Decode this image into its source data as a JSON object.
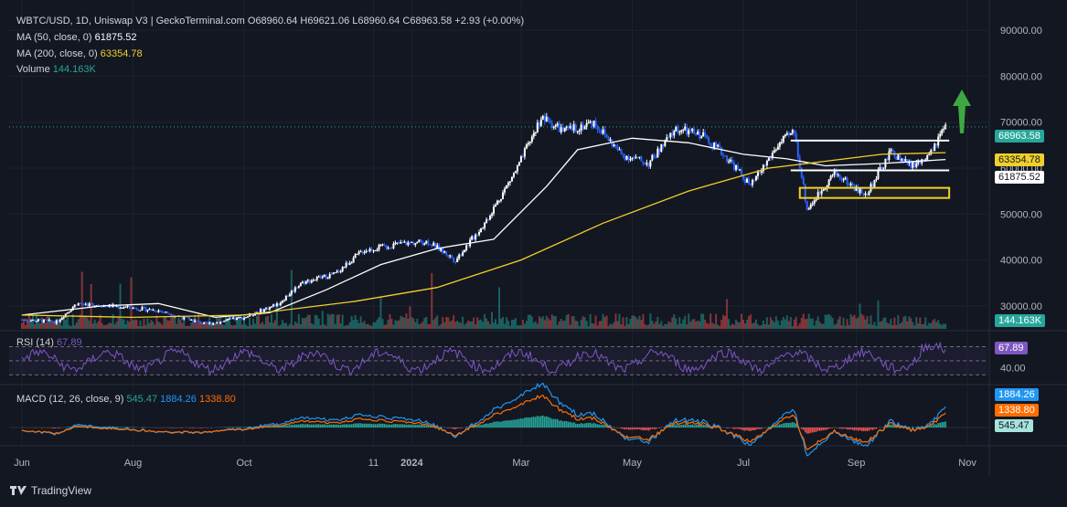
{
  "header": {
    "symbol": "WBTC/USD, 1D, Uniswap V3 | GeckoTerminal.com",
    "o_label": "O",
    "o": "68960.64",
    "h_label": "H",
    "h": "69621.06",
    "l_label": "L",
    "l": "68960.64",
    "c_label": "C",
    "c": "68963.58",
    "change": "+2.93 (+0.00%)"
  },
  "indicators": {
    "ma50_label": "MA (50, close, 0)",
    "ma50_value": "61875.52",
    "ma200_label": "MA (200, close, 0)",
    "ma200_value": "63354.78",
    "volume_label": "Volume",
    "volume_value": "144.163K",
    "rsi_label": "RSI (14)",
    "rsi_value": "67.89",
    "rsi_axis_40": "40.00",
    "macd_label": "MACD (12, 26, close, 9)",
    "macd_hist": "545.47",
    "macd_line": "1884.26",
    "macd_signal": "1338.80"
  },
  "price_tags": {
    "last": "68963.58",
    "ma200": "63354.78",
    "ma50": "61875.52",
    "volume": "144.163K",
    "rsi": "67.89",
    "macd_line": "1884.26",
    "macd_signal": "1338.80",
    "macd_hist": "545.47"
  },
  "colors": {
    "background": "#131722",
    "up": "#ffffff",
    "down": "#2962ff",
    "ma50": "#ffffff",
    "ma200": "#f0d02a",
    "rsi": "#7e57c2",
    "macd": "#2196f3",
    "signal": "#ff6d00",
    "last_price": "#26a69a",
    "arrow": "#3ea843"
  },
  "footer": {
    "brand": "TradingView"
  },
  "chart_data": {
    "type": "line",
    "title": "WBTC/USD, 1D, Uniswap V3",
    "y_ticks": [
      "90000.00",
      "80000.00",
      "70000.00",
      "60000.00",
      "50000.00",
      "40000.00",
      "30000.00"
    ],
    "ylim": [
      25000,
      95000
    ],
    "x_ticks": [
      "Jun",
      "Aug",
      "Oct",
      "11",
      "2024",
      "Mar",
      "May",
      "Jul",
      "Sep",
      "Nov"
    ],
    "x_dates": [
      "2023-06-01",
      "2023-08-01",
      "2023-10-01",
      "2023-12-11",
      "2024-01-01",
      "2024-03-01",
      "2024-05-01",
      "2024-07-01",
      "2024-09-01",
      "2024-11-01"
    ],
    "series": [
      {
        "name": "Price",
        "x": [
          "2023-06-01",
          "2023-06-20",
          "2023-07-01",
          "2023-07-20",
          "2023-08-15",
          "2023-09-10",
          "2023-10-01",
          "2023-10-20",
          "2023-11-01",
          "2023-11-20",
          "2023-12-05",
          "2023-12-25",
          "2024-01-10",
          "2024-01-25",
          "2024-02-10",
          "2024-02-28",
          "2024-03-12",
          "2024-03-25",
          "2024-04-10",
          "2024-04-25",
          "2024-05-10",
          "2024-05-25",
          "2024-06-10",
          "2024-06-25",
          "2024-07-05",
          "2024-07-20",
          "2024-07-29",
          "2024-08-05",
          "2024-08-20",
          "2024-09-06",
          "2024-09-20",
          "2024-10-01",
          "2024-10-10",
          "2024-10-20"
        ],
        "values": [
          27000,
          26500,
          30500,
          30000,
          29000,
          26000,
          27500,
          30500,
          35000,
          37000,
          42000,
          43500,
          44000,
          40000,
          48000,
          60000,
          71000,
          68000,
          70000,
          63000,
          61000,
          68500,
          67000,
          61000,
          56000,
          65000,
          68000,
          51000,
          59000,
          54000,
          63500,
          60500,
          62000,
          68963.58
        ]
      },
      {
        "name": "MA (50, close, 0)",
        "x": [
          "2023-06-01",
          "2023-07-15",
          "2023-08-15",
          "2023-09-15",
          "2023-10-15",
          "2023-11-15",
          "2023-12-15",
          "2024-01-15",
          "2024-02-15",
          "2024-03-15",
          "2024-04-01",
          "2024-05-01",
          "2024-06-01",
          "2024-07-01",
          "2024-07-25",
          "2024-08-15",
          "2024-09-15",
          "2024-10-20"
        ],
        "values": [
          28000,
          30000,
          30500,
          27500,
          28500,
          33500,
          39000,
          42500,
          44500,
          56000,
          64000,
          66500,
          65500,
          63000,
          62000,
          60500,
          61000,
          61875.52
        ]
      },
      {
        "name": "MA (200, close, 0)",
        "x": [
          "2023-06-01",
          "2023-08-01",
          "2023-10-01",
          "2023-12-01",
          "2024-01-15",
          "2024-03-01",
          "2024-04-15",
          "2024-06-01",
          "2024-07-15",
          "2024-08-15",
          "2024-09-15",
          "2024-10-20"
        ],
        "values": [
          28000,
          27500,
          28000,
          31000,
          34000,
          40000,
          48000,
          55000,
          60000,
          61500,
          63000,
          63354.78
        ]
      }
    ],
    "annotations": {
      "resistance_line": 66000,
      "support_line": 59500,
      "demand_zone": [
        53500,
        55700
      ]
    },
    "volume": {
      "last": "144.163K"
    },
    "rsi": {
      "last": 67.89,
      "levels": [
        70,
        50,
        30
      ]
    },
    "macd": {
      "macd": 1884.26,
      "signal": 1338.8,
      "histogram": 545.47
    }
  }
}
